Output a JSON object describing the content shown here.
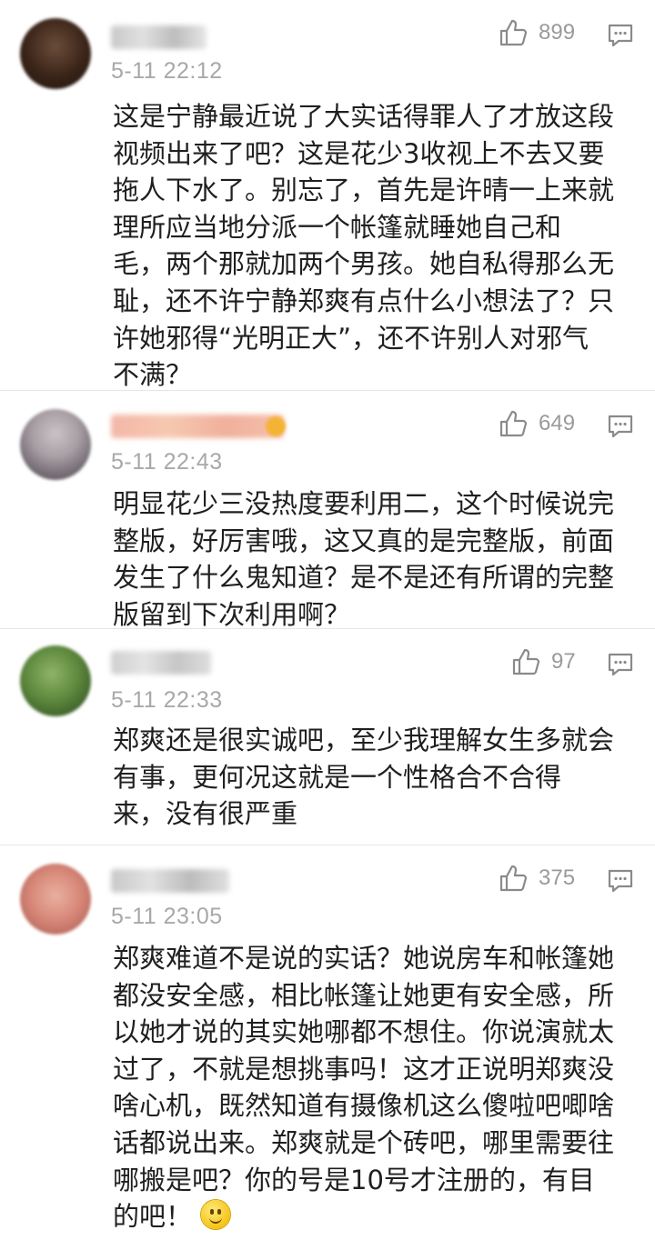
{
  "comments": [
    {
      "username": "LV_J&J",
      "timestamp": "5-11 22:12",
      "likes": "899",
      "text": "这是宁静最近说了大实话得罪人了才放这段\n视频出来了吧？这是花少3收视上不去又要\n拖人下水了。别忘了，首先是许晴一上来就\n理所应当地分派一个帐篷就睡她自己和\n毛，两个那就加两个男孩。她自私得那么无\n耻，还不许宁静郑爽有点什么小想法了？只\n许她邪得“光明正大”，还不许别人对邪气\n不满？"
    },
    {
      "username": "",
      "timestamp": "5-11 22:43",
      "likes": "649",
      "text": "明显花少三没热度要利用二，这个时候说完\n整版，好厉害哦，这又真的是完整版，前面\n发生了什么鬼知道？是不是还有所谓的完整\n版留到下次利用啊？"
    },
    {
      "username": "",
      "timestamp": "5-11 22:33",
      "likes": "97",
      "text": "郑爽还是很实诚吧，至少我理解女生多就会\n有事，更何况这就是一个性格合不合得\n来，没有很严重"
    },
    {
      "username": "",
      "timestamp": "5-11 23:05",
      "likes": "375",
      "text": "郑爽难道不是说的实话？她说房车和帐篷她\n都没安全感，相比帐篷让她更有安全感，所\n以她才说的其实她哪都不想住。你说演就太\n过了，不就是想挑事吗！这才正说明郑爽没\n啥心机，既然知道有摄像机这么傻啦吧唧啥\n话都说出来。郑爽就是个砖吧，哪里需要往\n哪搬是吧？你的号是10号才注册的，有目\n的吧！"
    }
  ],
  "icons": {
    "like": "thumbs-up-icon",
    "reply": "comment-reply-icon",
    "emoji": "smile-emoji-icon"
  },
  "colors": {
    "text": "#1f1f1f",
    "meta": "#a8a8a8",
    "divider": "#e6e6e6"
  }
}
